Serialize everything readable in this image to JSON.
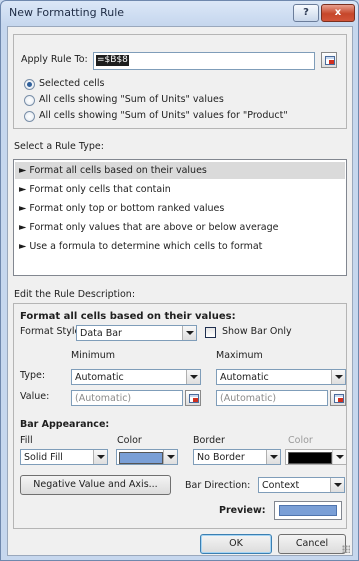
{
  "dialog": {
    "title": "New Formatting Rule",
    "help_icon": "?",
    "close_icon": "x"
  },
  "apply_rule": {
    "label": "Apply Rule To:",
    "value": "=$B$8",
    "options": [
      {
        "label": "Selected cells",
        "selected": true
      },
      {
        "label": "All cells showing \"Sum of Units\" values",
        "selected": false
      },
      {
        "label": "All cells showing \"Sum of Units\" values for \"Product\"",
        "selected": false
      }
    ]
  },
  "rule_type": {
    "label": "Select a Rule Type:",
    "items": [
      "► Format all cells based on their values",
      "► Format only cells that contain",
      "► Format only top or bottom ranked values",
      "► Format only values that are above or below average",
      "► Use a formula to determine which cells to format"
    ],
    "selected_index": 0
  },
  "description": {
    "label": "Edit the Rule Description:",
    "heading": "Format all cells based on their values:",
    "format_style_label": "Format Style:",
    "format_style_value": "Data Bar",
    "show_bar_only_label": "Show Bar Only",
    "minimum_header": "Minimum",
    "maximum_header": "Maximum",
    "type_label": "Type:",
    "value_label": "Value:",
    "min_type": "Automatic",
    "max_type": "Automatic",
    "min_value": "(Automatic)",
    "max_value": "(Automatic)"
  },
  "bar_appearance": {
    "heading": "Bar Appearance:",
    "fill_label": "Fill",
    "color_label": "Color",
    "border_label": "Border",
    "border_color_label": "Color",
    "fill_value": "Solid Fill",
    "border_value": "No Border",
    "fill_color": "#7a9fd6",
    "border_color": "#000000",
    "negative_button": "Negative Value and Axis...",
    "bar_direction_label": "Bar Direction:",
    "bar_direction_value": "Context",
    "preview_label": "Preview:"
  },
  "buttons": {
    "ok": "OK",
    "cancel": "Cancel"
  }
}
